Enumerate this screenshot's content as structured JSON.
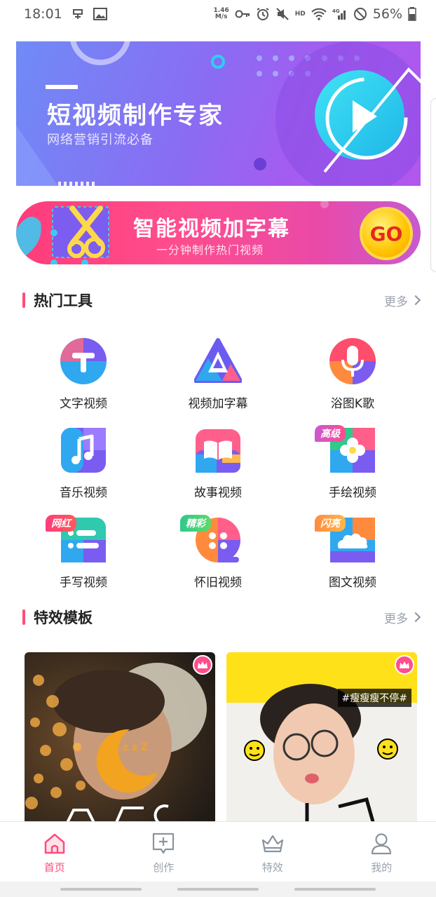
{
  "status_bar": {
    "time": "18:01",
    "net_speed": "1.46",
    "net_unit": "M/s",
    "hd": "HD",
    "network": "4G",
    "battery": "56%"
  },
  "banners": {
    "video_expert": {
      "title": "短视频制作专家",
      "subtitle": "网络营销引流必备"
    },
    "subtitle_promo": {
      "title": "智能视频加字幕",
      "subtitle": "一分钟制作热门视频",
      "go": "GO"
    }
  },
  "hot_tools": {
    "title": "热门工具",
    "more": "更多",
    "items": [
      {
        "label": "文字视频",
        "icon": "text-t-icon"
      },
      {
        "label": "视频加字幕",
        "icon": "triangle-a-icon"
      },
      {
        "label": "浴图K歌",
        "icon": "microphone-icon"
      },
      {
        "label": "音乐视频",
        "icon": "music-note-icon"
      },
      {
        "label": "故事视频",
        "icon": "book-icon"
      },
      {
        "label": "手绘视频",
        "icon": "flower-icon",
        "badge": "高级"
      },
      {
        "label": "手写视频",
        "icon": "handwriting-lines-icon",
        "badge": "网红"
      },
      {
        "label": "怀旧视频",
        "icon": "film-reel-icon",
        "badge": "精彩"
      },
      {
        "label": "图文视频",
        "icon": "cloud-image-icon",
        "badge": "闪亮"
      }
    ]
  },
  "effects": {
    "title": "特效模板",
    "more": "更多",
    "templates": [
      {
        "name": "moon-sleep-template"
      },
      {
        "name": "slim-template",
        "hashtag": "#瘦瘦瘦不停#"
      }
    ]
  },
  "bottom_nav": [
    {
      "label": "首页",
      "icon": "home-icon",
      "active": true
    },
    {
      "label": "创作",
      "icon": "create-plus-icon"
    },
    {
      "label": "特效",
      "icon": "crown-icon"
    },
    {
      "label": "我的",
      "icon": "profile-icon"
    }
  ],
  "colors": {
    "accent": "#ff4d78",
    "inactive": "#9aa2ad"
  }
}
